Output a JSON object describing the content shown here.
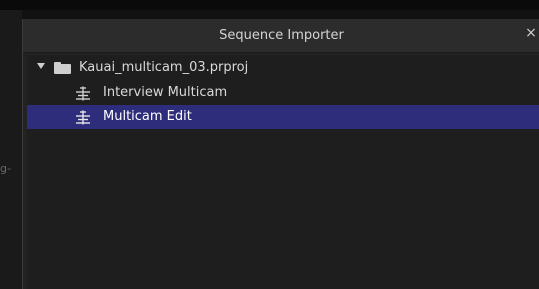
{
  "dialog": {
    "title": "Sequence Importer",
    "close_glyph": "×"
  },
  "background": {
    "edge_hint": "g-"
  },
  "tree": {
    "project": {
      "name": "Kauai_multicam_03.prproj",
      "expanded": true,
      "icon": "folder-icon"
    },
    "items": [
      {
        "label": "Interview Multicam",
        "icon": "sequence-icon",
        "selected": false
      },
      {
        "label": "Multicam Edit",
        "icon": "sequence-icon",
        "selected": true
      }
    ]
  },
  "colors": {
    "selection": "#2e2d7b",
    "panel": "#1e1e1e",
    "titlebar": "#2c2c2c"
  }
}
